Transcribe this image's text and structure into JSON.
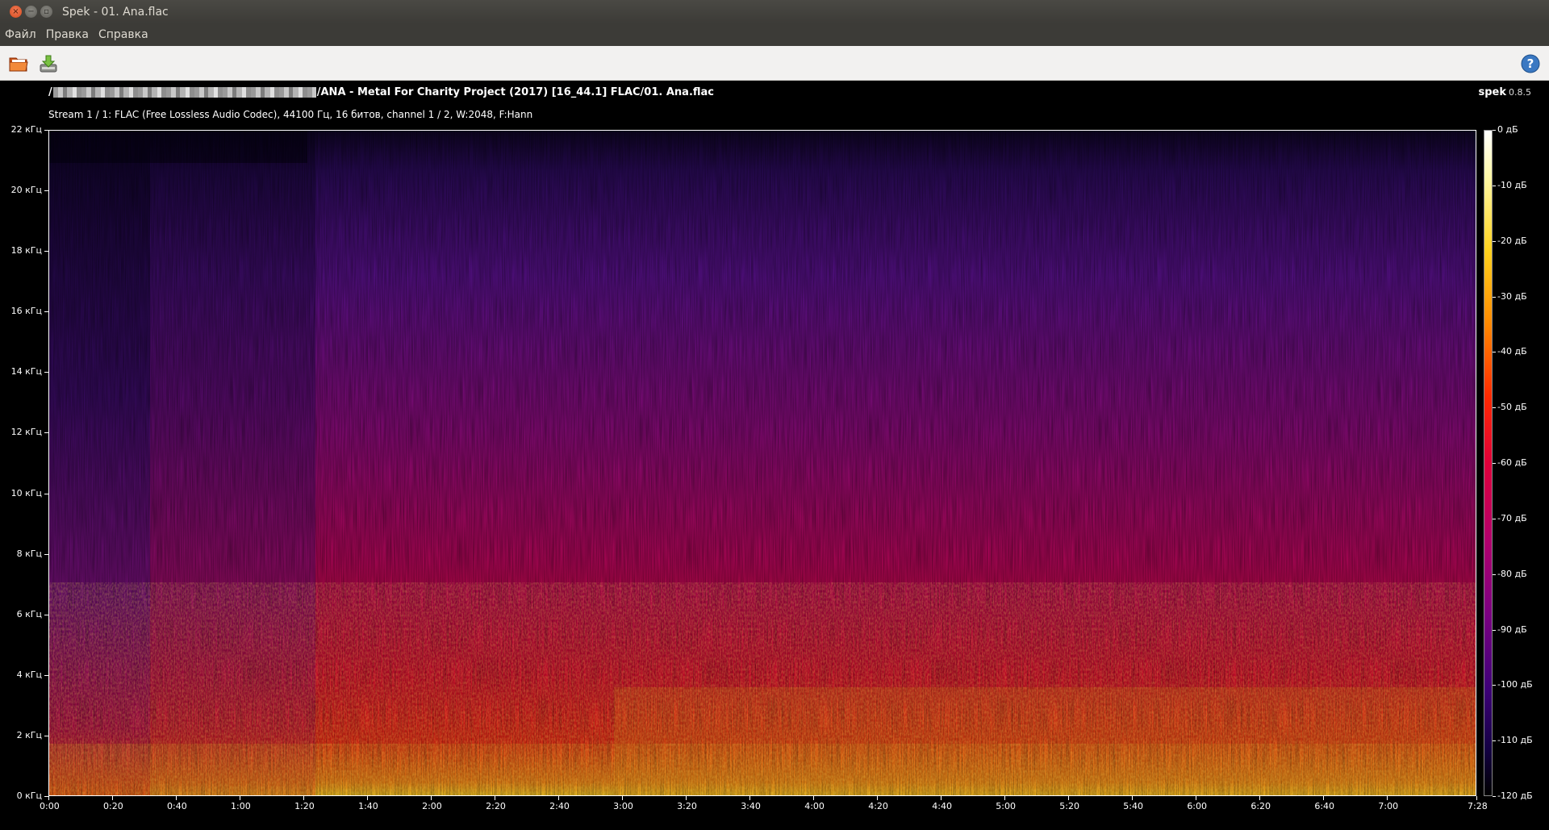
{
  "window": {
    "title": "Spek - 01. Ana.flac"
  },
  "menu": {
    "items": [
      "Файл",
      "Правка",
      "Справка"
    ]
  },
  "toolbar": {
    "open_icon": "folder-open-icon",
    "save_icon": "save-download-icon",
    "help_icon": "help-icon"
  },
  "file": {
    "path_prefix": "/",
    "path_suffix": "/ANA - Metal For Charity Project (2017) [16_44.1] FLAC/01. Ana.flac",
    "stream_info": "Stream 1 / 1: FLAC (Free Lossless Audio Codec), 44100 Гц, 16 битов, channel 1 / 2, W:2048, F:Hann"
  },
  "brand": {
    "name": "spek",
    "version": "0.8.5"
  },
  "chart_data": {
    "type": "heatmap",
    "y_axis": {
      "ticks": [
        "22 кГц",
        "20 кГц",
        "18 кГц",
        "16 кГц",
        "14 кГц",
        "12 кГц",
        "10 кГц",
        "8 кГц",
        "6 кГц",
        "4 кГц",
        "2 кГц",
        "0 кГц"
      ],
      "range": [
        0,
        22
      ]
    },
    "x_axis": {
      "ticks": [
        "0:00",
        "0:20",
        "0:40",
        "1:00",
        "1:20",
        "1:40",
        "2:00",
        "2:20",
        "2:40",
        "3:00",
        "3:20",
        "3:40",
        "4:00",
        "4:20",
        "4:40",
        "5:00",
        "5:20",
        "5:40",
        "6:00",
        "6:20",
        "6:40",
        "7:00",
        "7:28"
      ],
      "range_seconds": [
        0,
        448
      ]
    },
    "colorbar": {
      "ticks": [
        "0 дБ",
        "-10 дБ",
        "-20 дБ",
        "-30 дБ",
        "-40 дБ",
        "-50 дБ",
        "-60 дБ",
        "-70 дБ",
        "-80 дБ",
        "-90 дБ",
        "-100 дБ",
        "-110 дБ",
        "-120 дБ"
      ],
      "range_db": [
        -120,
        0
      ]
    }
  }
}
